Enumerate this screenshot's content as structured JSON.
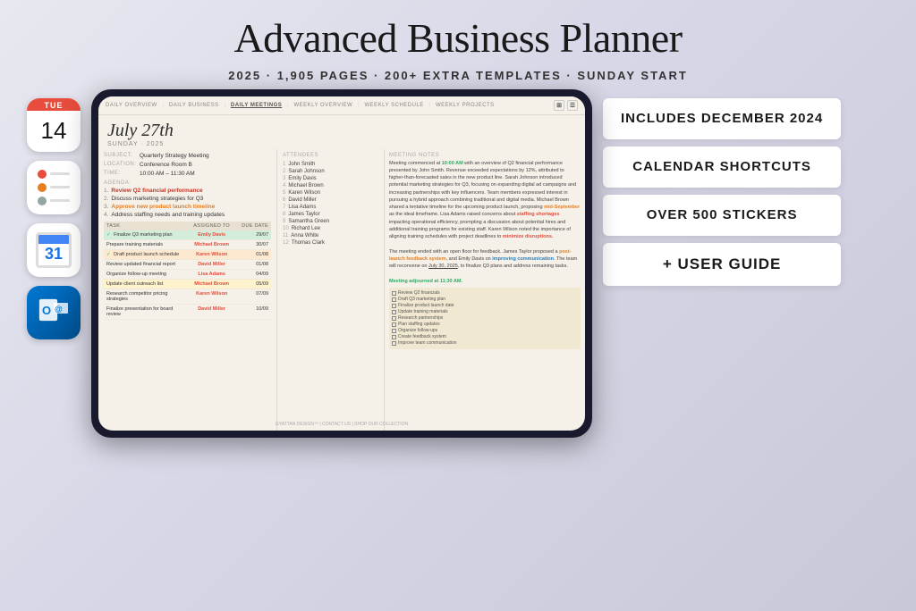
{
  "header": {
    "title": "Advanced Business Planner",
    "subtitle": "2025  ·  1,905 PAGES  ·  200+ EXTRA TEMPLATES  ·  SUNDAY START"
  },
  "nav": {
    "items": [
      "DAILY OVERVIEW",
      "DAILY BUSINESS",
      "DAILY MEETINGS",
      "WEEKLY OVERVIEW",
      "WEEKLY SCHEDULE",
      "WEEKLY PROJECTS"
    ]
  },
  "planner": {
    "date": "July 27th",
    "day": "SUNDAY · 2025",
    "subject_label": "SUBJECT:",
    "subject_value": "Quarterly Strategy Meeting",
    "location_label": "LOCATION:",
    "location_value": "Conference Room B",
    "time_label": "TIME:",
    "time_value": "10:00 AM – 11:30 AM",
    "agenda_label": "AGENDA:",
    "agenda_items": [
      {
        "num": "1.",
        "text": "Review Q2 financial performance"
      },
      {
        "num": "2.",
        "text": "Discuss marketing strategies for Q3"
      },
      {
        "num": "3.",
        "text": "Approve new product launch timeline"
      },
      {
        "num": "4.",
        "text": "Address staffing needs and training updates"
      }
    ],
    "tasks_header": [
      "TASK",
      "ASSIGNED TO",
      "DUE DATE"
    ],
    "tasks": [
      {
        "check": true,
        "name": "Finalize Q3 marketing plan",
        "assigned": "Emily Davis",
        "due": "29/07",
        "color": "green"
      },
      {
        "check": false,
        "name": "Prepare training materials",
        "assigned": "Michael Brown",
        "due": "30/07",
        "color": ""
      },
      {
        "check": true,
        "name": "Draft product launch schedule",
        "assigned": "Karen Wilson",
        "due": "01/08",
        "color": "orange"
      },
      {
        "check": false,
        "name": "Review updated financial report",
        "assigned": "David Miller",
        "due": "01/08",
        "color": ""
      },
      {
        "check": false,
        "name": "Organize follow-up meeting",
        "assigned": "Lisa Adams",
        "due": "04/09",
        "color": ""
      },
      {
        "check": false,
        "name": "Update client outreach list",
        "assigned": "Michael Brown",
        "due": "05/09",
        "color": "yellow"
      },
      {
        "check": false,
        "name": "Research competitor pricing strategies",
        "assigned": "Karen Wilson",
        "due": "07/09",
        "color": ""
      },
      {
        "check": false,
        "name": "Finalize presentation for board review",
        "assigned": "David Miller",
        "due": "10/09",
        "color": ""
      }
    ],
    "attendees_label": "ATTENDEES",
    "attendees": [
      "John Smith",
      "Sarah Johnson",
      "Emily Davis",
      "Michael Brown",
      "Karen Wilson",
      "David Miller",
      "Lisa Adams",
      "James Taylor",
      "Samantha Green",
      "Richard Lee",
      "Anna White",
      "Thomas Clark"
    ],
    "notes_label": "MEETING NOTES",
    "notes": "Meeting commenced at 10:00 AM with an overview of Q2 financial performance presented by John Smith. Revenue exceeded expectations by 12%, attributed to higher-than-forecasted sales in the new product line. Sarah Johnson introduced potential marketing strategies for Q3, focusing on expanding digital ad campaigns and increasing partnerships with key influencers. Team members expressed interest in pursuing a hybrid approach combining traditional and digital media. Michael Brown shared a tentative timeline for the upcoming product launch, proposing mid-September as the ideal timeframe. Lisa Adams raised concerns about staffing shortages impacting operational efficiency, prompting a discussion about potential hires and additional training programs for existing staff. Karen Wilson noted the importance of aligning training schedules with project deadlines to minimize disruptions.\n\nThe meeting ended with an open floor for feedback. James Taylor proposed a post-launch feedback system, and Emily Davis on improving communication. The team will reconvene on July 30, 2025, to finalize Q3 plans and address remaining tasks.\n\nMeeting adjourned at 11:30 AM.",
    "checklist": [
      "Review Q2 financials",
      "Draft Q3 marketing plan",
      "Finalize product launch date",
      "Update training materials",
      "Research partnerships",
      "Plan staffing updates",
      "Organize follow-ups",
      "Create feedback system",
      "Improve team communication"
    ]
  },
  "app_icons": {
    "calendar_day": "TUE",
    "calendar_num": "14",
    "gcal_num": "31"
  },
  "cards": [
    {
      "label": "INCLUDES DECEMBER 2024"
    },
    {
      "label": "CALENDAR SHORTCUTS"
    },
    {
      "label": "OVER 500 STICKERS"
    },
    {
      "label": "+ USER GUIDE",
      "large": true
    }
  ]
}
